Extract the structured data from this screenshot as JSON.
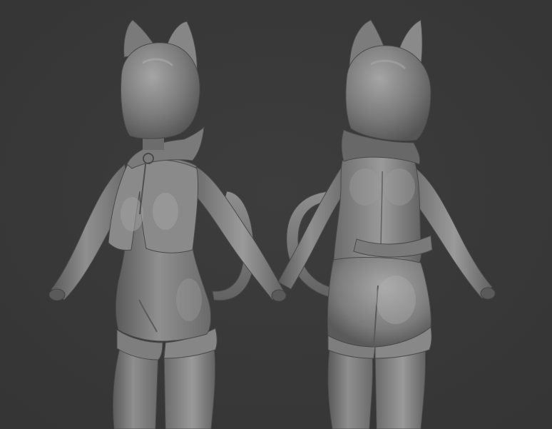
{
  "scene": {
    "background_color": "#3a3a3a",
    "material_base_color": "#8a8a8a",
    "material_highlight_color": "#bdbdbd",
    "material_shadow_color": "#4e4e4e",
    "figures": [
      {
        "view": "front",
        "description_icon": "cat-helmet-figure-front"
      },
      {
        "view": "back",
        "description_icon": "cat-helmet-figure-back"
      }
    ]
  }
}
